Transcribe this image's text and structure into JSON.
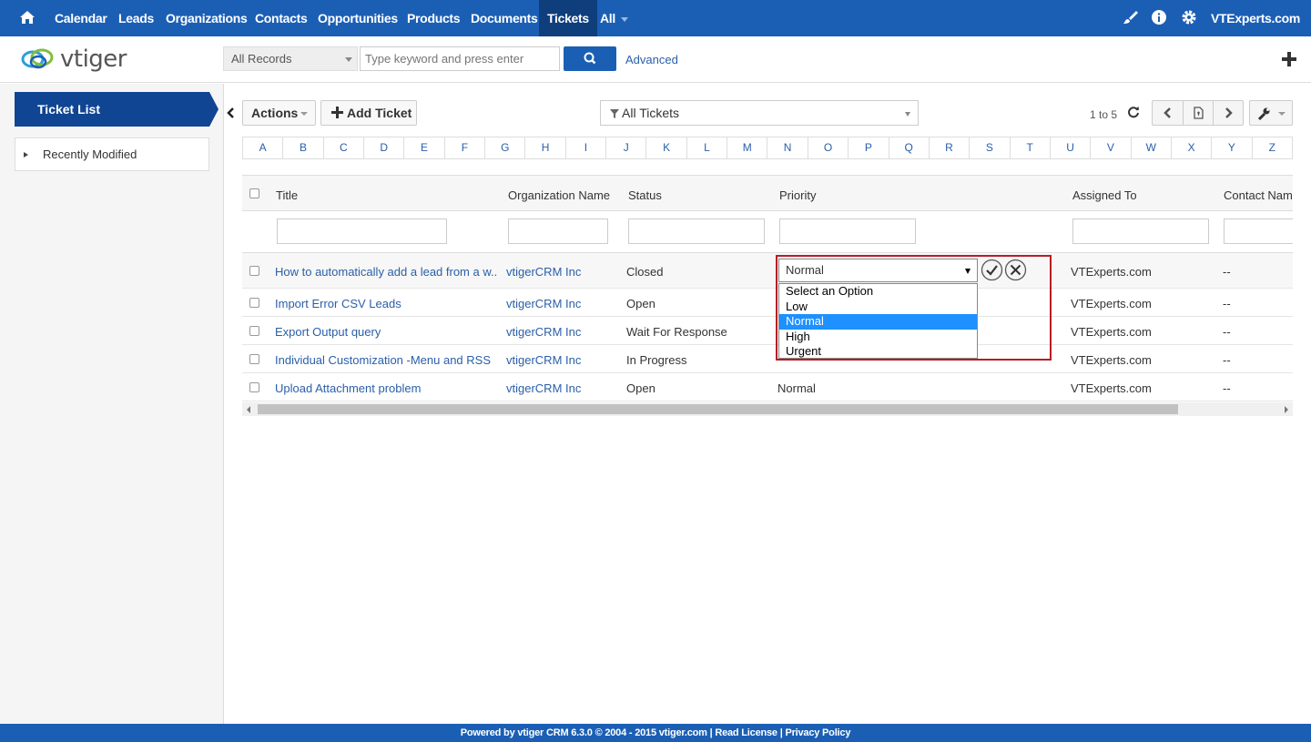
{
  "nav": {
    "items": [
      {
        "label": "Calendar"
      },
      {
        "label": "Leads"
      },
      {
        "label": "Organizations"
      },
      {
        "label": "Contacts"
      },
      {
        "label": "Opportunities"
      },
      {
        "label": "Products"
      },
      {
        "label": "Documents"
      },
      {
        "label": "Tickets"
      },
      {
        "label": "All"
      }
    ],
    "user": "VTExperts.com"
  },
  "header": {
    "logo_text": "vtiger",
    "record_scope": "All Records",
    "search_placeholder": "Type keyword and press enter",
    "advanced_label": "Advanced"
  },
  "sidebar": {
    "title": "Ticket List",
    "recent_label": "Recently Modified"
  },
  "toolbar": {
    "actions_label": "Actions",
    "add_label": "Add Ticket",
    "filter_value": "All Tickets",
    "pager_text": "1 to 5"
  },
  "alphabet": [
    "A",
    "B",
    "C",
    "D",
    "E",
    "F",
    "G",
    "H",
    "I",
    "J",
    "K",
    "L",
    "M",
    "N",
    "O",
    "P",
    "Q",
    "R",
    "S",
    "T",
    "U",
    "V",
    "W",
    "X",
    "Y",
    "Z"
  ],
  "table": {
    "columns": [
      "Title",
      "Organization Name",
      "Status",
      "Priority",
      "Assigned To",
      "Contact Name"
    ],
    "rows": [
      {
        "title": "How to automatically add a lead from a w...",
        "org": "vtigerCRM Inc",
        "status": "Closed",
        "priority": "",
        "assigned": "VTExperts.com",
        "contact": "--"
      },
      {
        "title": "Import Error CSV Leads",
        "org": "vtigerCRM Inc",
        "status": "Open",
        "priority": "",
        "assigned": "VTExperts.com",
        "contact": "--"
      },
      {
        "title": "Export Output query",
        "org": "vtigerCRM Inc",
        "status": "Wait For Response",
        "priority": "",
        "assigned": "VTExperts.com",
        "contact": "--"
      },
      {
        "title": "Individual Customization -Menu and RSS",
        "org": "vtigerCRM Inc",
        "status": "In Progress",
        "priority": "",
        "assigned": "VTExperts.com",
        "contact": "--"
      },
      {
        "title": "Upload Attachment problem",
        "org": "vtigerCRM Inc",
        "status": "Open",
        "priority": "Normal",
        "assigned": "VTExperts.com",
        "contact": "--"
      }
    ]
  },
  "inline_edit": {
    "selected": "Normal",
    "options": [
      "Select an Option",
      "Low",
      "Normal",
      "High",
      "Urgent"
    ]
  },
  "footer": {
    "text": "Powered by vtiger CRM 6.3.0  © 2004 - 2015  vtiger.com | Read License | Privacy Policy"
  },
  "colors": {
    "nav_bg": "#1b5fb5",
    "active_tab": "#0f3e7d",
    "link": "#2a5fa8",
    "highlight_border": "#b81d25",
    "option_selected": "#1e90ff"
  }
}
